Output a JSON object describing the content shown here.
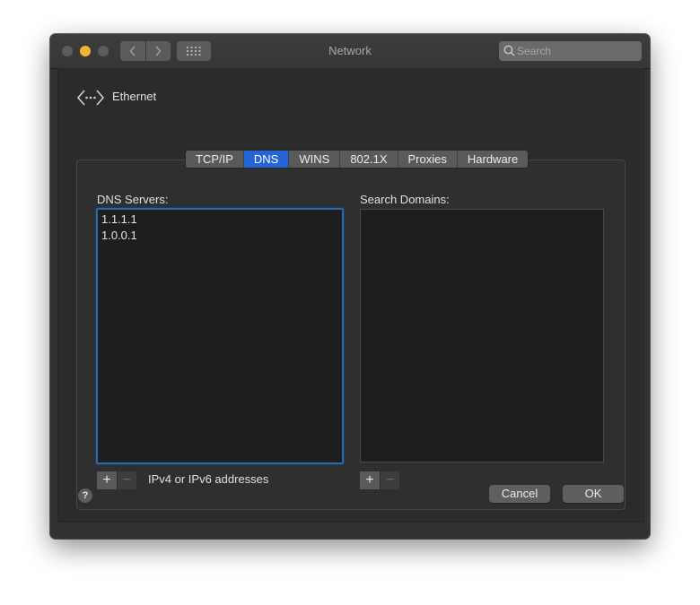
{
  "window": {
    "title": "Network",
    "search_placeholder": "Search"
  },
  "interface": {
    "name": "Ethernet",
    "icon": "ethernet-icon"
  },
  "tabs": [
    {
      "label": "TCP/IP",
      "active": false
    },
    {
      "label": "DNS",
      "active": true
    },
    {
      "label": "WINS",
      "active": false
    },
    {
      "label": "802.1X",
      "active": false
    },
    {
      "label": "Proxies",
      "active": false
    },
    {
      "label": "Hardware",
      "active": false
    }
  ],
  "dns_servers": {
    "label": "DNS Servers:",
    "entries": [
      "1.1.1.1",
      "1.0.0.1"
    ],
    "hint": "IPv4 or IPv6 addresses"
  },
  "search_domains": {
    "label": "Search Domains:",
    "entries": []
  },
  "controls": {
    "add_glyph": "+",
    "remove_glyph": "−",
    "help_glyph": "?"
  },
  "buttons": {
    "cancel": "Cancel",
    "ok": "OK"
  },
  "colors": {
    "accent": "#2564d6",
    "focus_ring": "#2c6aa3",
    "minimize": "#f0b436"
  }
}
